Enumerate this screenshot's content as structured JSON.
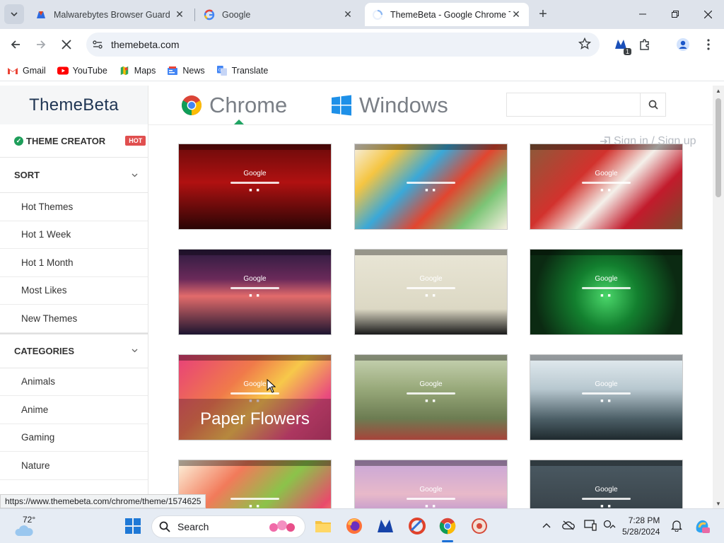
{
  "browser": {
    "tabs": [
      {
        "title": "Malwarebytes Browser Guard",
        "active": false
      },
      {
        "title": "Google",
        "active": false
      },
      {
        "title": "ThemeBeta - Google Chrome Th",
        "active": true
      }
    ],
    "url": "themebeta.com",
    "extension_badge": "1",
    "bookmarks": [
      {
        "label": "Gmail",
        "icon": "gmail-icon"
      },
      {
        "label": "YouTube",
        "icon": "youtube-icon"
      },
      {
        "label": "Maps",
        "icon": "maps-icon"
      },
      {
        "label": "News",
        "icon": "news-icon"
      },
      {
        "label": "Translate",
        "icon": "translate-icon"
      }
    ],
    "status_url": "https://www.themebeta.com/chrome/theme/1574625"
  },
  "site": {
    "brand": "ThemeBeta",
    "theme_creator": "THEME CREATOR",
    "hot_badge": "HOT",
    "sort_label": "SORT",
    "sort_items": [
      "Hot Themes",
      "Hot 1 Week",
      "Hot 1 Month",
      "Most Likes",
      "New Themes"
    ],
    "categories_label": "CATEGORIES",
    "category_items": [
      "Animals",
      "Anime",
      "Gaming",
      "Nature"
    ],
    "nav": [
      {
        "label": "Chrome",
        "active": true
      },
      {
        "label": "Windows",
        "active": false
      }
    ],
    "signin": "Sign in / Sign up",
    "card_search_logo": "Google",
    "hover_title": "Paper Flowers",
    "themes": [
      {
        "bg": "linear-gradient(180deg,#6b0a0a 0%,#b01111 45%,#2a0505 100%)",
        "logo": "Google"
      },
      {
        "bg": "linear-gradient(135deg,#f7f1e4 0%,#f5c542 20%,#3aa8d8 40%,#e2452f 60%,#7cc576 80%,#f6efe0 100%)",
        "logo": ""
      },
      {
        "bg": "linear-gradient(135deg,#8b5a3a 0%,#d2322d 35%,#f4f0ea 55%,#c21b2c 75%,#7a4a2c 100%)",
        "logo": "Google"
      },
      {
        "bg": "linear-gradient(180deg,#2c1b3f 0%,#6b2a5a 35%,#e26b6b 55%,#1d1530 100%)",
        "logo": "Google"
      },
      {
        "bg": "linear-gradient(180deg,#e9e6d6 0%,#dcd8c4 70%,#1a1a1a 100%)",
        "logo": "Google"
      },
      {
        "bg": "radial-gradient(circle at 50% 55%,#4ad66a 0%,#13802f 35%,#0b2a12 80%)",
        "logo": "Google"
      },
      {
        "bg": "linear-gradient(135deg,#e8407a 0%,#f07a4a 35%,#f7c84a 55%,#e94a7e 80%,#c63a6a 100%)",
        "logo": "Google"
      },
      {
        "bg": "linear-gradient(180deg,#c9d4b4 0%,#98a97a 40%,#6c7c52 75%,#a7443a 100%)",
        "logo": "Google"
      },
      {
        "bg": "linear-gradient(180deg,#e6eef2 0%,#b8c8d0 40%,#4d6068 75%,#1f2a2e 100%)",
        "logo": "Google"
      },
      {
        "bg": "linear-gradient(135deg,#fdf3dc 0%,#f27a5a 30%,#8bc34a 55%,#e94b6b 80%,#f7d26a 100%)",
        "logo": ""
      },
      {
        "bg": "linear-gradient(180deg,#c8a6d8 0%,#e8b9c9 40%,#b48fcf 70%,#3a3a5a 100%)",
        "logo": "Google"
      },
      {
        "bg": "linear-gradient(180deg,#4b5a63 0%,#3c474e 50%,#1f262b 100%)",
        "logo": "Google"
      }
    ]
  },
  "taskbar": {
    "temperature": "72°",
    "search_placeholder": "Search",
    "time": "7:28 PM",
    "date": "5/28/2024"
  }
}
